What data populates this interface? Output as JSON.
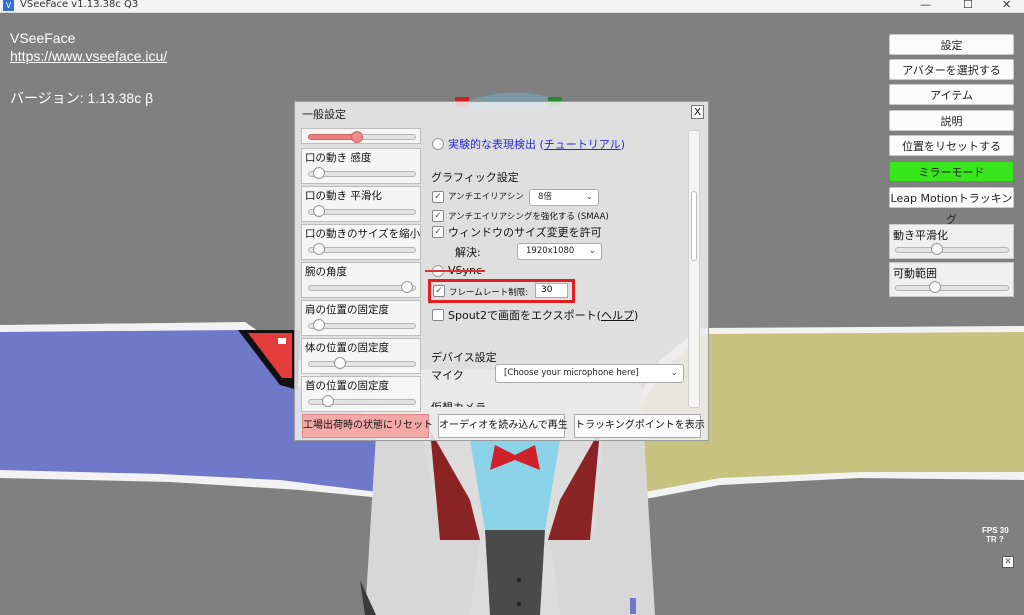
{
  "window": {
    "title": "VSeeFace v1.13.38c Q3",
    "minimize": "—",
    "maximize": "☐",
    "close": "✕"
  },
  "info": {
    "app_name": "VSeeFace",
    "url": "https://www.vseeface.icu/",
    "version": "バージョン: 1.13.38c β"
  },
  "right_buttons": [
    {
      "label": "設定"
    },
    {
      "label": "アバターを選択する"
    },
    {
      "label": "アイテム"
    },
    {
      "label": "説明"
    },
    {
      "label": "位置をリセットする"
    },
    {
      "label": "ミラーモード"
    },
    {
      "label": "Leap Motionトラッキング"
    }
  ],
  "right_sliders": [
    {
      "label": "動き平滑化",
      "value": 0.35
    },
    {
      "label": "可動範囲",
      "value": 0.33
    }
  ],
  "fps": {
    "label": "FPS 30",
    "tr": "TR  ?"
  },
  "dialog": {
    "title": "一般設定",
    "close": "X",
    "left_settings": [
      {
        "label": "",
        "value": 0.45
      },
      {
        "label": "口の動き 感度",
        "value": 0.05
      },
      {
        "label": "口の動き 平滑化",
        "value": 0.05
      },
      {
        "label": "口の動きのサイズを縮小",
        "value": 0.05
      },
      {
        "label": "腕の角度",
        "value": 0.97
      },
      {
        "label": "肩の位置の固定度",
        "value": 0.05
      },
      {
        "label": "体の位置の固定度",
        "value": 0.27
      },
      {
        "label": "首の位置の固定度",
        "value": 0.15
      }
    ],
    "experimental": {
      "prefix": "実験的な表現検出 (",
      "link": "チュートリアル",
      "suffix": ")"
    },
    "graphics_heading": "グラフィック設定",
    "antialias": {
      "label": "アンチエイリアシン",
      "value": "8倍"
    },
    "smaa": "アンチエイリアシングを強化する (SMAA)",
    "resize": "ウィンドウのサイズ変更を許可",
    "resolution": {
      "label": "解決:",
      "value": "1920x1080"
    },
    "vsync": "VSync",
    "framerate": {
      "label": "フレームレート制限:",
      "value": "30"
    },
    "spout": {
      "prefix": "Spout2で画面をエクスポート(",
      "link": "ヘルプ",
      "suffix": ")"
    },
    "device_heading": "デバイス設定",
    "mic": {
      "label": "マイク",
      "value": "[Choose your microphone here]"
    },
    "virtual_camera": "仮想カメラ",
    "bottom_buttons": {
      "reset": "工場出荷時の状態にリセット",
      "audio": "オーディオを読み込んで再生",
      "tracking": "トラッキングポイントを表示"
    }
  }
}
